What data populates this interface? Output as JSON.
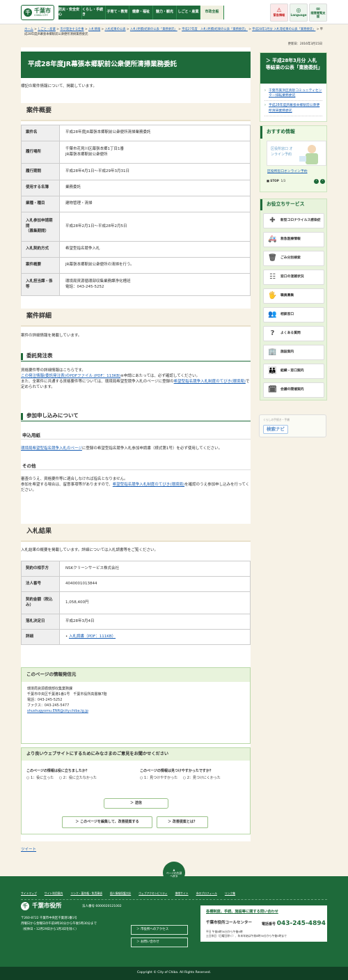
{
  "header": {
    "logo": {
      "name": "千葉市",
      "en": "CHIBA CITY"
    },
    "nav": [
      "防災・安全安心",
      "くらし・手続き",
      "子育て・教育",
      "健康・福祉",
      "魅力・観光",
      "しごと・産業",
      "市政全般"
    ],
    "emergency": "緊急情報",
    "language": "Language",
    "visual": "随意閲覧支援"
  },
  "breadcrumb": {
    "items": [
      "ホーム",
      "しごと・産業",
      "市が発注する仕事",
      "入札情報",
      "入札結果の公表",
      "入札(見積)結果の公表「業務委託」",
      "平成27年度　入札(見積)結果の公表「業務委託」",
      "平成28年3月分 入札等結果の公表「業務委託」"
    ],
    "current": "平成28年度JR幕張本郷駅前公衆便所清掃業務委託"
  },
  "updated": "更新日：2016年3月15日",
  "page_title": "平成28年度JR幕張本郷駅前公衆便所清掃業務委託",
  "intro": "標記の案件情報について、掲載しています。",
  "overview": {
    "heading": "案件概要",
    "rows": [
      {
        "th": "案件名",
        "td": "平成28年度JR幕張本郷駅前公衆便所清掃業務委託"
      },
      {
        "th": "履行場所",
        "td": "千葉市花見川区幕張本郷1丁目1番\nJR幕張本郷駅前公衆便所"
      },
      {
        "th": "履行期間",
        "td": "平成28年4月1日～平成29年3月31日"
      },
      {
        "th": "使用する名簿",
        "td": "業務委託"
      },
      {
        "th": "業種・種目",
        "td": "建物管理・清掃"
      },
      {
        "th": "入札参加申請期間\n（募集期間）",
        "td": "平成28年2月1日～平成28年2月5日"
      },
      {
        "th": "入札契約方式",
        "td": "希望型指名競争入札"
      },
      {
        "th": "案件概要",
        "td": "JR幕張本郷駅前公衆便所の清掃を行う。"
      },
      {
        "th": "入札担当課・係等",
        "td": "環境局資源循環部収集業務課浄化槽班\n電話：043-245-5252"
      }
    ]
  },
  "detail": {
    "heading": "案件詳細",
    "intro": "案件の詳細情報を掲載しています。",
    "s1": {
      "heading": "委託発注表",
      "t1": "資格要件等の詳細情報はこちらです。",
      "link1": "この発注情報(委託発注表)のPDFファイル (PDF：113KB)",
      "t2": "※申請にあたっては、必ず確認してください。",
      "t3": "また、全案件に共通する資格要件等については、環境局希望型競争入札のページに登録の",
      "link2": "希望型指名競争入札制度のてびき(環境局)",
      "t4": "で定められています。"
    },
    "s2": {
      "heading": "参加申し込みについて",
      "h4a": "申込用紙",
      "link3": "環境局希望型指名競争入札のページ",
      "t5": "に登録の希望型指名競争入札参加申請書（様式第1号）を必ず使用してください。",
      "h4b": "その他",
      "t6": "審査のうえ、資格要件等に適合しなければ指名となりません。",
      "t7": "参加を希望する場合は、留意事項等がありますので、",
      "link4": "希望型指名競争入札制度のてびき(環境局)",
      "t8": "を確認のうえ参加申し込みを行ってください。"
    }
  },
  "result": {
    "heading": "入札結果",
    "intro": "入札結果の概要を掲載しています。詳細については入札調書等をご覧ください。",
    "rows": [
      {
        "th": "契約の相手方",
        "td": "NSKクリーンサービス株式会社"
      },
      {
        "th": "法人番号",
        "td": "4040001013844"
      },
      {
        "th": "契約金額（税込み）",
        "td": "1,058,400円"
      },
      {
        "th": "落札決定日",
        "td": "平成28年3月4日"
      }
    ],
    "detail_th": "詳細",
    "detail_link": "入札調書（PDF：111KB）"
  },
  "contact": {
    "heading": "このページの情報発信元",
    "lines": [
      "環境局資源循環部収集業務課",
      "千葉市中央区千葉港1番1号　千葉市役所高層棟7階",
      "電話：043-245-5252",
      "ファクス：043-245-5477"
    ],
    "email": "shushugyomu.ENR@city.chiba.lg.jp"
  },
  "survey": {
    "heading": "より良いウェブサイトにするためにみなさまのご意見をお聞かせください",
    "q1": "このページの情報は役に立ちましたか？",
    "q1o": [
      "1：役に立った",
      "2：役に立たなかった"
    ],
    "q2": "このページの情報は見つけやすかったですか？",
    "q2o": [
      "1：見つけやすかった",
      "2：見つけにくかった"
    ],
    "send": "送信",
    "edit": "このページを編集して、改善提案する",
    "what": "改善提案とは？"
  },
  "tweet": "ツイート",
  "side": {
    "bid_title": "平成28年3月分 入札等結果の公表「業務委託」",
    "bid_links": [
      "千葉市美浜区真砂コミュニティセンター排転業務委託",
      "平成28年度JR幕張本郷駅前公衆便所清掃業務委託"
    ],
    "rec_title": "おすすめ情報",
    "rec_img": "区役所窓口 オンライン予約",
    "rec_link": "区役所窓口オンライン予約",
    "stop": "STOP",
    "page": "1/3",
    "help_title": "お役立ちサービス",
    "help": [
      "新型コロナウイルス感染症",
      "救急医療情報",
      "ごみ分別検索",
      "窓口の混雑状況",
      "職員募集",
      "相談窓口",
      "よくある質問",
      "施設案内",
      "組織・窓口案内",
      "会議の開催案内"
    ],
    "help_icons": [
      "✚",
      "🚑",
      "🗑",
      "☷",
      "🖐",
      "👥",
      "?",
      "🏢",
      "👪",
      "🗓"
    ],
    "navi_small": "くらしの手続き・手順",
    "navi": "検索ナビ"
  },
  "pagetop": "ページの先頭へ戻る",
  "footer": {
    "links": [
      "サイトマップ",
      "サイト利用案内",
      "リンク・著作権・免責事項",
      "個人情報保護方針",
      "ウェブアクセシビリティ",
      "携帯サイト",
      "市のプロフィール",
      "リンク集"
    ],
    "org": "千葉市役所",
    "corp": "法人番号 6000020121002",
    "addr": [
      "〒260-8722 千葉市中央区千葉港1番1号",
      "月曜日から金曜日の午前8時30分から午後5時30分まで",
      "（祝休日・12月29日から1月3日を除く）"
    ],
    "btn1": "市役所へのアクセス",
    "btn2": "お問い合わせ",
    "call_title": "各種制度、手続、施設等に関する問い合わせ",
    "call_name": "千葉市役所コールセンター",
    "tel_label": "電話番号",
    "tel": "043-245-4894",
    "hours": [
      "平日 午前8時30分から午後9時",
      "土日休日（日曜日除く）、年末年始は午前8時30分から午後5時まで"
    ]
  },
  "copyright": "Copyright © City of Chiba. All Rights Reserved."
}
